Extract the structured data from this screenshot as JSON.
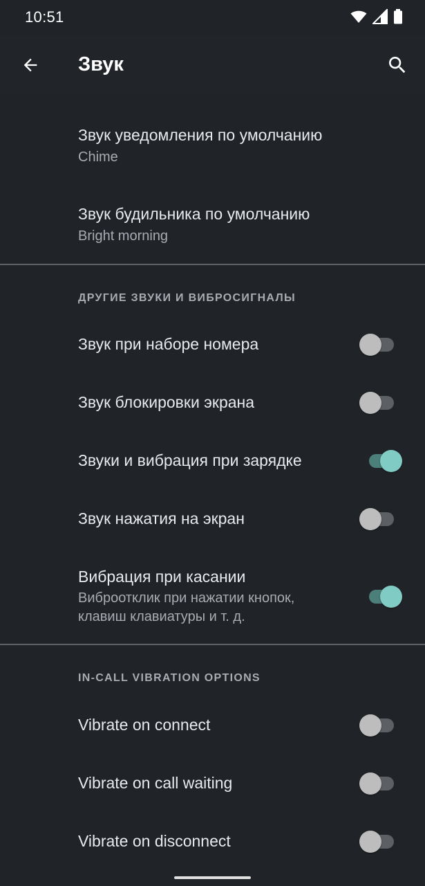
{
  "status": {
    "time": "10:51"
  },
  "appbar": {
    "title": "Звук"
  },
  "prefs_top": [
    {
      "title": "Звук уведомления по умолчанию",
      "summary": "Chime"
    },
    {
      "title": "Звук будильника по умолчанию",
      "summary": "Bright morning"
    }
  ],
  "category_other": "ДРУГИЕ ЗВУКИ И ВИБРОСИГНАЛЫ",
  "other_items": [
    {
      "title": "Звук при наборе номера",
      "on": false
    },
    {
      "title": "Звук блокировки экрана",
      "on": false
    },
    {
      "title": "Звуки и вибрация при зарядке",
      "on": true
    },
    {
      "title": "Звук нажатия на экран",
      "on": false
    },
    {
      "title": "Вибрация при касании",
      "summary_line1": "Виброотклик при нажатии кнопок,",
      "summary_line2": "клавиш клавиатуры и т. д.",
      "on": true
    }
  ],
  "category_incall": "IN-CALL VIBRATION OPTIONS",
  "incall_items": [
    {
      "title": "Vibrate on connect",
      "on": false
    },
    {
      "title": "Vibrate on call waiting",
      "on": false
    },
    {
      "title": "Vibrate on disconnect",
      "on": false
    }
  ],
  "colors": {
    "background": "#202327",
    "accent": "#80cbc4",
    "divider": "#5f6368"
  }
}
